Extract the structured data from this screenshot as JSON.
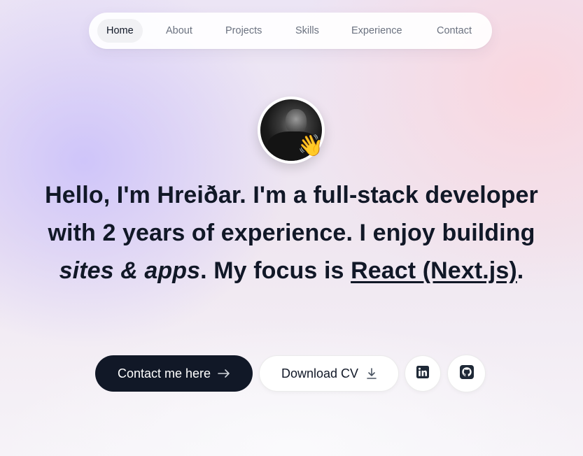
{
  "nav": {
    "items": [
      {
        "label": "Home",
        "active": true
      },
      {
        "label": "About",
        "active": false
      },
      {
        "label": "Projects",
        "active": false
      },
      {
        "label": "Skills",
        "active": false
      },
      {
        "label": "Experience",
        "active": false
      },
      {
        "label": "Contact",
        "active": false
      }
    ]
  },
  "hero": {
    "avatar_emoji": "👋",
    "headline": {
      "greeting": "Hello, I'm Hreiðar.",
      "t1": " I'm a ",
      "role": "full-stack developer",
      "t2": " with ",
      "years": "2 years",
      "t3": " of experience. I enjoy building ",
      "what": "sites & apps",
      "t4": ". My focus is ",
      "focus": "React (Next.js)",
      "t5": "."
    }
  },
  "actions": {
    "contact_label": "Contact me here",
    "cv_label": "Download CV",
    "linkedin_icon": "linkedin-icon",
    "github_icon": "github-icon"
  },
  "colors": {
    "primary_button": "#111827",
    "text": "#111827",
    "nav_inactive": "#6b7280"
  }
}
